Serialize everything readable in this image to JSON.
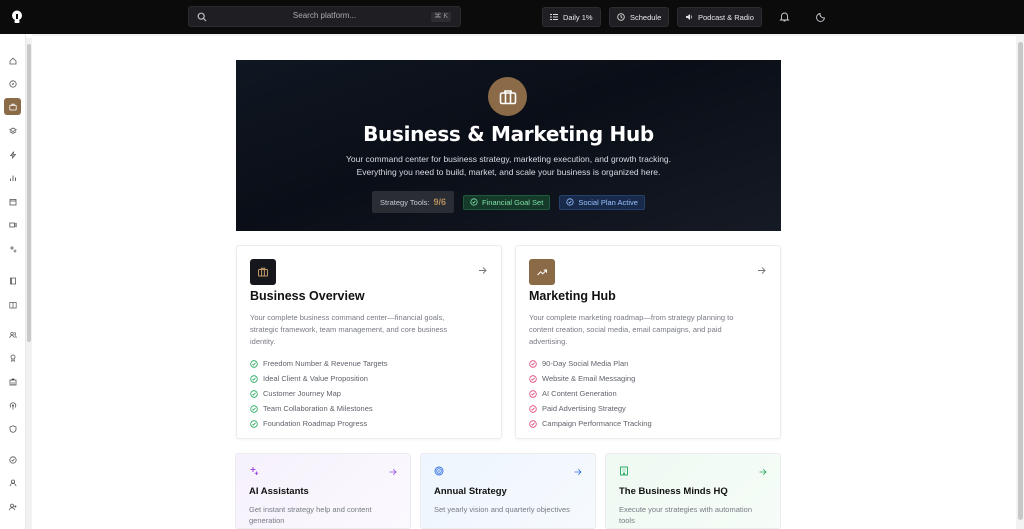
{
  "topbar": {
    "search_placeholder": "Search platform...",
    "search_shortcut": "⌘ K",
    "daily_label": "Daily 1%",
    "schedule_label": "Schedule",
    "podcast_label": "Podcast & Radio"
  },
  "sidebar": {
    "items": [
      {
        "icon": "home-icon"
      },
      {
        "icon": "compass-icon"
      },
      {
        "icon": "briefcase-icon",
        "active": true
      },
      {
        "icon": "layers-icon"
      },
      {
        "icon": "lightning-icon"
      },
      {
        "icon": "bar-chart-icon"
      },
      {
        "icon": "calendar-icon"
      },
      {
        "icon": "video-icon"
      },
      {
        "icon": "sparkles-icon"
      },
      {
        "icon": "book-icon"
      },
      {
        "icon": "book-open-icon"
      },
      {
        "icon": "users-icon"
      },
      {
        "icon": "award-icon"
      },
      {
        "icon": "building-icon"
      },
      {
        "icon": "podcast-icon"
      },
      {
        "icon": "shield-icon"
      },
      {
        "icon": "check-circle-icon"
      },
      {
        "icon": "user-icon"
      },
      {
        "icon": "user-plus-icon"
      }
    ]
  },
  "hero": {
    "title": "Business & Marketing Hub",
    "subtitle_line1": "Your command center for business strategy, marketing execution, and growth tracking.",
    "subtitle_line2": "Everything you need to build, market, and scale your business is organized here.",
    "tools_label": "Strategy Tools:",
    "tools_count": "9/6",
    "badge_goal": "Financial Goal Set",
    "badge_social": "Social Plan Active"
  },
  "business": {
    "title": "Business Overview",
    "desc": "Your complete business command center—financial goals, strategic framework, team management, and core business identity.",
    "items": [
      "Freedom Number & Revenue Targets",
      "Ideal Client & Value Proposition",
      "Customer Journey Map",
      "Team Collaboration & Milestones",
      "Foundation Roadmap Progress"
    ]
  },
  "marketing": {
    "title": "Marketing Hub",
    "desc": "Your complete marketing roadmap—from strategy planning to content creation, social media, email campaigns, and paid advertising.",
    "items": [
      "90-Day Social Media Plan",
      "Website & Email Messaging",
      "AI Content Generation",
      "Paid Advertising Strategy",
      "Campaign Performance Tracking"
    ]
  },
  "mini_cards": [
    {
      "title": "AI Assistants",
      "desc": "Get instant strategy help and content generation"
    },
    {
      "title": "Annual Strategy",
      "desc": "Set yearly vision and quarterly objectives"
    },
    {
      "title": "The Business Minds HQ",
      "desc": "Execute your strategies with automation tools"
    }
  ],
  "colors": {
    "accent": "#8b6a48",
    "hero_bg": "#0d121b",
    "green_check": "#22a55a",
    "pink_check": "#e0457b"
  }
}
